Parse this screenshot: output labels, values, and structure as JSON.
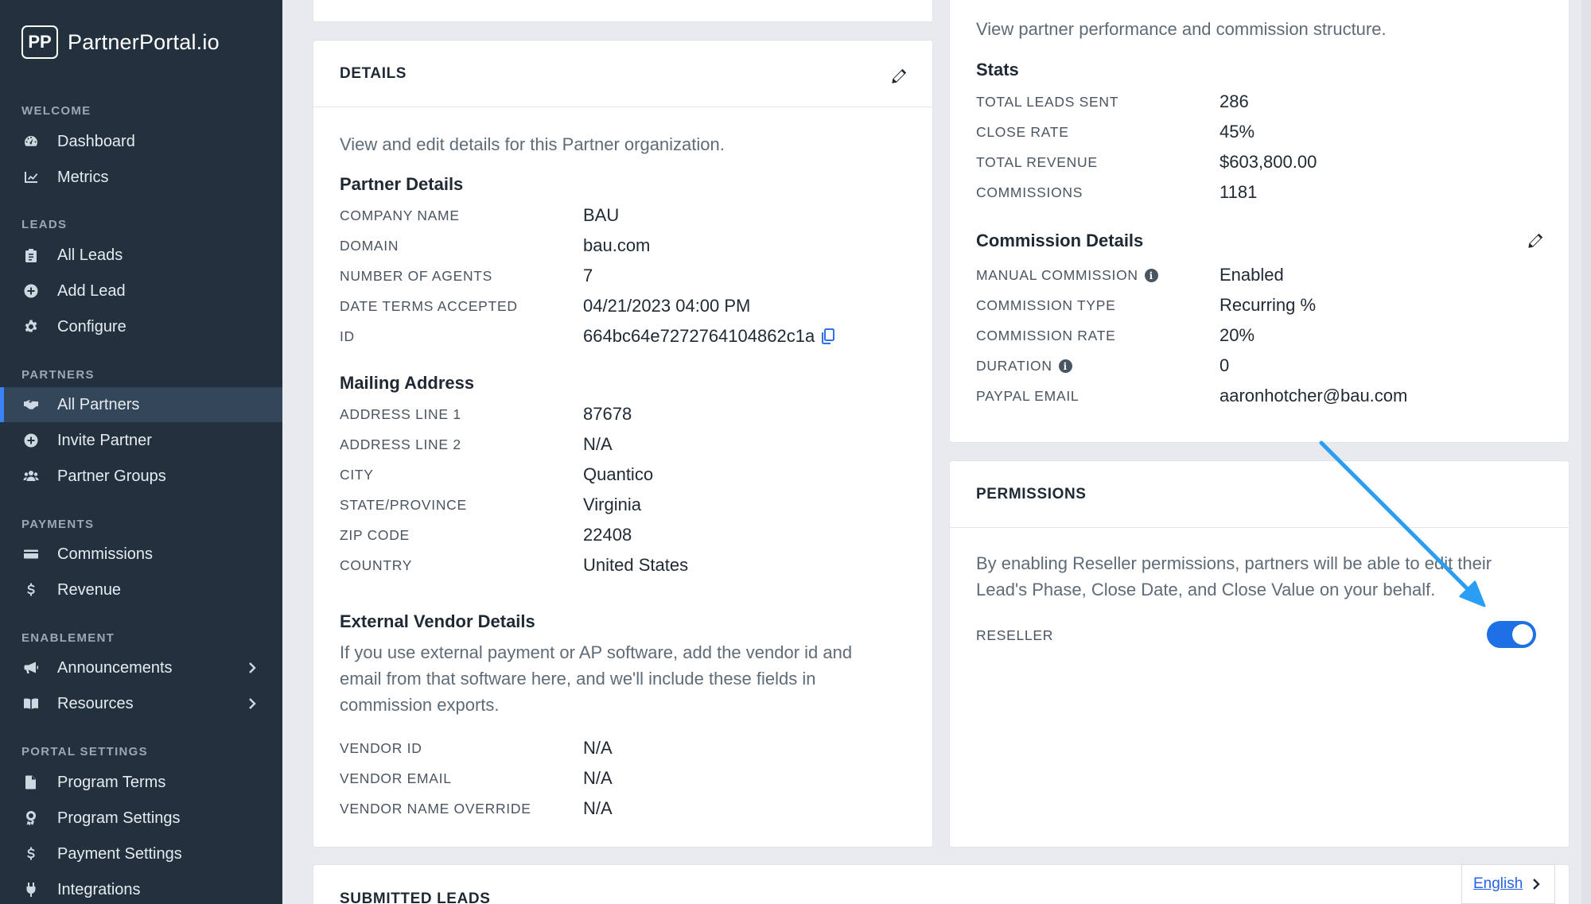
{
  "brand": {
    "logo_mark": "PP",
    "name": "PartnerPortal.io"
  },
  "sidebar": {
    "sections": [
      {
        "title": "WELCOME",
        "items": [
          {
            "label": "Dashboard",
            "icon": "gauge-icon"
          },
          {
            "label": "Metrics",
            "icon": "chart-line-icon"
          }
        ]
      },
      {
        "title": "LEADS",
        "items": [
          {
            "label": "All Leads",
            "icon": "clipboard-icon"
          },
          {
            "label": "Add Lead",
            "icon": "plus-circle-icon"
          },
          {
            "label": "Configure",
            "icon": "gear-icon"
          }
        ]
      },
      {
        "title": "PARTNERS",
        "items": [
          {
            "label": "All Partners",
            "icon": "handshake-icon",
            "active": true
          },
          {
            "label": "Invite Partner",
            "icon": "plus-circle-icon"
          },
          {
            "label": "Partner Groups",
            "icon": "users-icon"
          }
        ]
      },
      {
        "title": "PAYMENTS",
        "items": [
          {
            "label": "Commissions",
            "icon": "credit-card-icon"
          },
          {
            "label": "Revenue",
            "icon": "dollar-icon"
          }
        ]
      },
      {
        "title": "ENABLEMENT",
        "items": [
          {
            "label": "Announcements",
            "icon": "megaphone-icon",
            "chevron": true
          },
          {
            "label": "Resources",
            "icon": "book-icon",
            "chevron": true
          }
        ]
      },
      {
        "title": "PORTAL SETTINGS",
        "items": [
          {
            "label": "Program Terms",
            "icon": "file-icon"
          },
          {
            "label": "Program Settings",
            "icon": "award-icon"
          },
          {
            "label": "Payment Settings",
            "icon": "dollar-icon"
          },
          {
            "label": "Integrations",
            "icon": "plug-icon"
          }
        ]
      }
    ]
  },
  "details": {
    "header": "DETAILS",
    "description": "View and edit details for this Partner organization.",
    "partner_heading": "Partner Details",
    "partner_fields": [
      {
        "label": "COMPANY NAME",
        "value": "BAU"
      },
      {
        "label": "DOMAIN",
        "value": "bau.com"
      },
      {
        "label": "NUMBER OF AGENTS",
        "value": "7"
      },
      {
        "label": "DATE TERMS ACCEPTED",
        "value": "04/21/2023 04:00 PM"
      },
      {
        "label": "ID",
        "value": "664bc64e7272764104862c1a"
      }
    ],
    "mailing_heading": "Mailing Address",
    "mailing_fields": [
      {
        "label": "ADDRESS LINE 1",
        "value": "87678"
      },
      {
        "label": "ADDRESS LINE 2",
        "value": "N/A"
      },
      {
        "label": "CITY",
        "value": "Quantico"
      },
      {
        "label": "STATE/PROVINCE",
        "value": "Virginia"
      },
      {
        "label": "ZIP CODE",
        "value": "22408"
      },
      {
        "label": "COUNTRY",
        "value": "United States"
      }
    ],
    "vendor_heading": "External Vendor Details",
    "vendor_description_1": "If you use external payment or AP software, add the vendor id and",
    "vendor_description_2": "email from that software here, and we'll include these fields in",
    "vendor_description_3": "commission exports.",
    "vendor_fields": [
      {
        "label": "VENDOR ID",
        "value": "N/A"
      },
      {
        "label": "VENDOR EMAIL",
        "value": "N/A"
      },
      {
        "label": "VENDOR NAME OVERRIDE",
        "value": "N/A"
      }
    ]
  },
  "performance": {
    "description": "View partner performance and commission structure.",
    "stats_heading": "Stats",
    "stats": [
      {
        "label": "TOTAL LEADS SENT",
        "value": "286"
      },
      {
        "label": "CLOSE RATE",
        "value": "45%"
      },
      {
        "label": "TOTAL REVENUE",
        "value": "$603,800.00"
      },
      {
        "label": "COMMISSIONS",
        "value": "1181"
      }
    ],
    "commission_heading": "Commission Details",
    "commission_fields": [
      {
        "label": "MANUAL COMMISSION",
        "value": "Enabled",
        "info": true
      },
      {
        "label": "COMMISSION TYPE",
        "value": "Recurring %"
      },
      {
        "label": "COMMISSION RATE",
        "value": "20%"
      },
      {
        "label": "DURATION",
        "value": "0",
        "info": true
      },
      {
        "label": "PAYPAL EMAIL",
        "value": "aaronhotcher@bau.com"
      }
    ]
  },
  "permissions": {
    "header": "PERMISSIONS",
    "description_1": "By enabling Reseller permissions, partners will be able to edit their",
    "description_2": "Lead's Phase, Close Date, and Close Value on your behalf.",
    "reseller_label": "RESELLER",
    "reseller_enabled": true
  },
  "submitted_leads": {
    "header": "SUBMITTED LEADS"
  },
  "language": {
    "label": "English"
  },
  "colors": {
    "sidebar": "#23313f",
    "accent": "#1f6fe5",
    "annotation_arrow": "#2a9df4"
  }
}
